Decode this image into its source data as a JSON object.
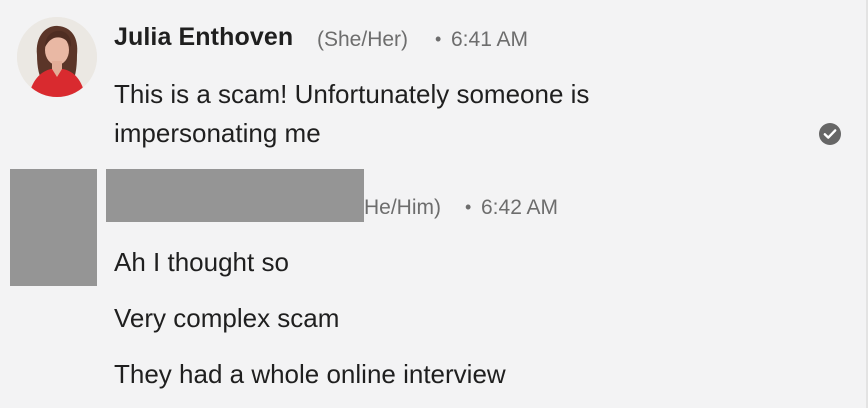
{
  "messages": [
    {
      "author": "Julia Enthoven",
      "pronouns": "(She/Her)",
      "separator": "•",
      "time": "6:41 AM",
      "lines": [
        "This is a scam! Unfortunately someone is",
        "impersonating me"
      ],
      "status_icon": "checkmark-circle-icon"
    },
    {
      "author_redacted": true,
      "pronouns": "He/Him)",
      "separator": "•",
      "time": "6:42 AM",
      "lines": [
        "Ah I thought so",
        "Very complex scam",
        "They had a whole online interview"
      ]
    }
  ],
  "colors": {
    "background": "#f3f3f4",
    "text": "#1f1f1f",
    "meta_text": "#6d6d6d",
    "redaction": "#959595",
    "status_icon": "#666666"
  }
}
